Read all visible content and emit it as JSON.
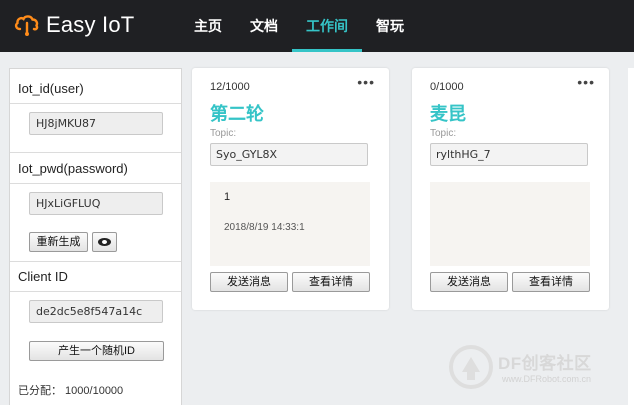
{
  "app": {
    "name": "Easy IoT"
  },
  "nav": {
    "items": [
      {
        "label": "主页"
      },
      {
        "label": "文档"
      },
      {
        "label": "工作间",
        "active": true
      },
      {
        "label": "智玩"
      }
    ]
  },
  "credentials": {
    "iot_id_label": "Iot_id(user)",
    "iot_id_value": "HJ8jMKU87",
    "iot_pwd_label": "Iot_pwd(password)",
    "iot_pwd_value": "HJxLiGFLUQ",
    "regenerate_button": "重新生成",
    "client_id_label": "Client ID",
    "client_id_value": "de2dc5e8f547a14c",
    "random_id_button": "产生一个随机ID",
    "allocated": "已分配：  1000/10000"
  },
  "cards": [
    {
      "count": "12/1000",
      "name": "第二轮",
      "topic_label": "Topic:",
      "topic": "Syo_GYL8X",
      "message_value": "1",
      "message_time": "2018/8/19 14:33:1",
      "send_button": "发送消息",
      "details_button": "查看详情"
    },
    {
      "count": "0/1000",
      "name": "麦昆",
      "topic_label": "Topic:",
      "topic": "rylthHG_7",
      "message_value": "",
      "message_time": "",
      "send_button": "发送消息",
      "details_button": "查看详情"
    }
  ],
  "watermark": {
    "title": "DF创客社区",
    "url": "www.DFRobot.com.cn"
  },
  "colors": {
    "accent": "#35c4c7",
    "topbar": "#1f2023",
    "background": "#eceef0"
  }
}
